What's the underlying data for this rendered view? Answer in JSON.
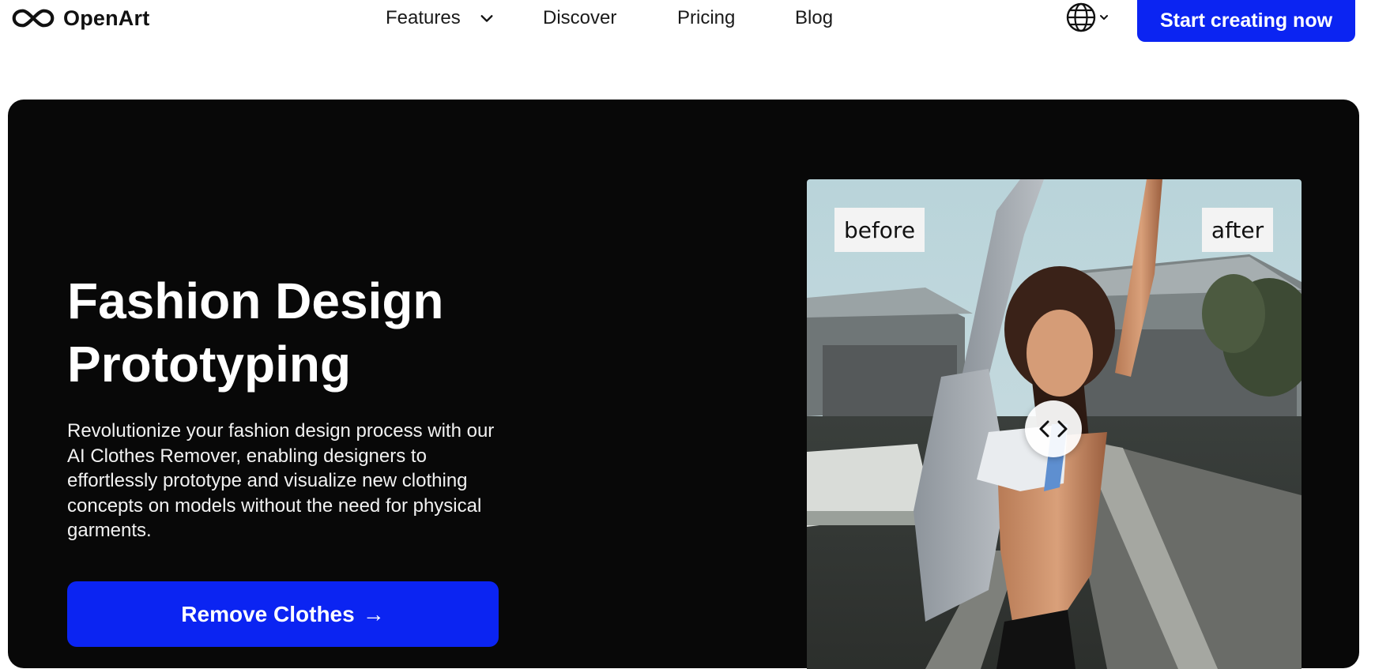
{
  "brand": {
    "name": "OpenArt"
  },
  "nav": {
    "features": "Features",
    "discover": "Discover",
    "pricing": "Pricing",
    "blog": "Blog"
  },
  "header": {
    "cta_label": "Start creating now"
  },
  "hero": {
    "title_line1": "Fashion Design",
    "title_line2": "Prototyping",
    "description": "Revolutionize your fashion design process with our AI Clothes Remover, enabling designers to effortlessly prototype and visualize new clothing concepts on models without the need for physical garments.",
    "cta_label": "Remove Clothes",
    "cta_arrow": "→"
  },
  "comparer": {
    "before_label": "before",
    "after_label": "after"
  },
  "colors": {
    "accent": "#0b24f2",
    "hero_bg": "#080808",
    "text_dark": "#111111"
  },
  "icons": {
    "logo": "infinity-logo-icon",
    "features_chevron": "chevron-down-icon",
    "language": "globe-icon",
    "slider": "left-right-arrows-icon"
  }
}
